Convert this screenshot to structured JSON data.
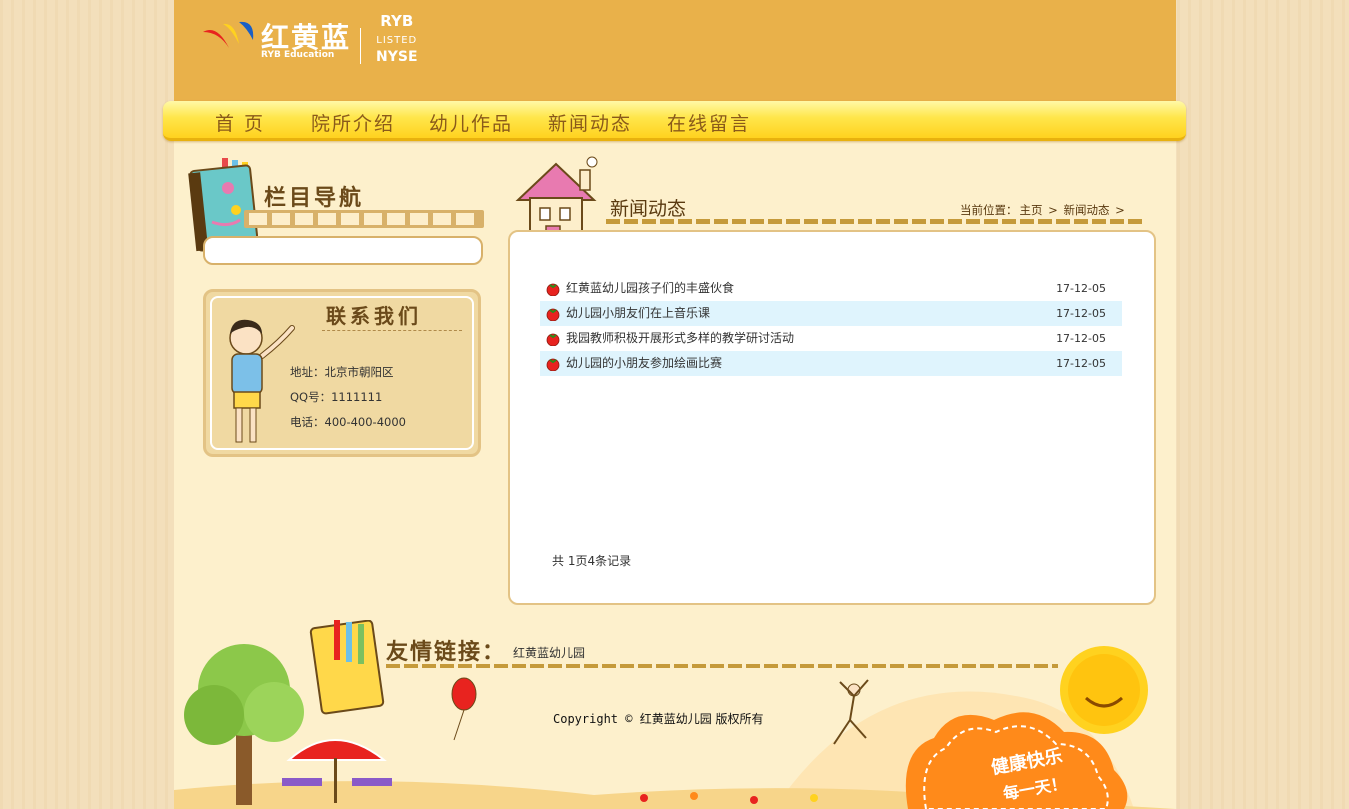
{
  "header": {
    "logo_cn": "红黄蓝",
    "logo_en": "RYB Education",
    "ticker_top": "RYB",
    "ticker_mid": "LISTED",
    "ticker_bottom": "NYSE"
  },
  "nav": {
    "items": [
      {
        "label": "首 页"
      },
      {
        "label": "院所介绍"
      },
      {
        "label": "幼儿作品"
      },
      {
        "label": "新闻动态"
      },
      {
        "label": "在线留言"
      }
    ]
  },
  "sidebar": {
    "title": "栏目导航",
    "contact": {
      "title": "联系我们",
      "address": "地址：北京市朝阳区",
      "qq": "QQ号：1111111",
      "phone": "电话：400-400-4000"
    }
  },
  "main": {
    "title": "新闻动态",
    "breadcrumb": {
      "prefix": "当前位置：",
      "home": "主页",
      "current": "新闻动态",
      "sep": ">"
    },
    "news": [
      {
        "title": "红黄蓝幼儿园孩子们的丰盛伙食",
        "date": "17-12-05"
      },
      {
        "title": "幼儿园小朋友们在上音乐课",
        "date": "17-12-05"
      },
      {
        "title": "我园教师积极开展形式多样的教学研讨活动",
        "date": "17-12-05"
      },
      {
        "title": "幼儿园的小朋友参加绘画比赛",
        "date": "17-12-05"
      }
    ],
    "pager": "共 1页4条记录"
  },
  "footer": {
    "friend_title": "友情链接：",
    "friend_link": "红黄蓝幼儿园",
    "copyright_prefix": "Copyright ©",
    "copyright_text": "红黄蓝幼儿园 版权所有",
    "slogan_1": "健康快乐",
    "slogan_2": "每一天！"
  },
  "colors": {
    "header_bg": "#e9b14a",
    "nav_yellow": "#ffe64a",
    "page_bg": "#fdf0cc",
    "accent_brown": "#c59a3a",
    "row_alt": "#dff4fd"
  }
}
